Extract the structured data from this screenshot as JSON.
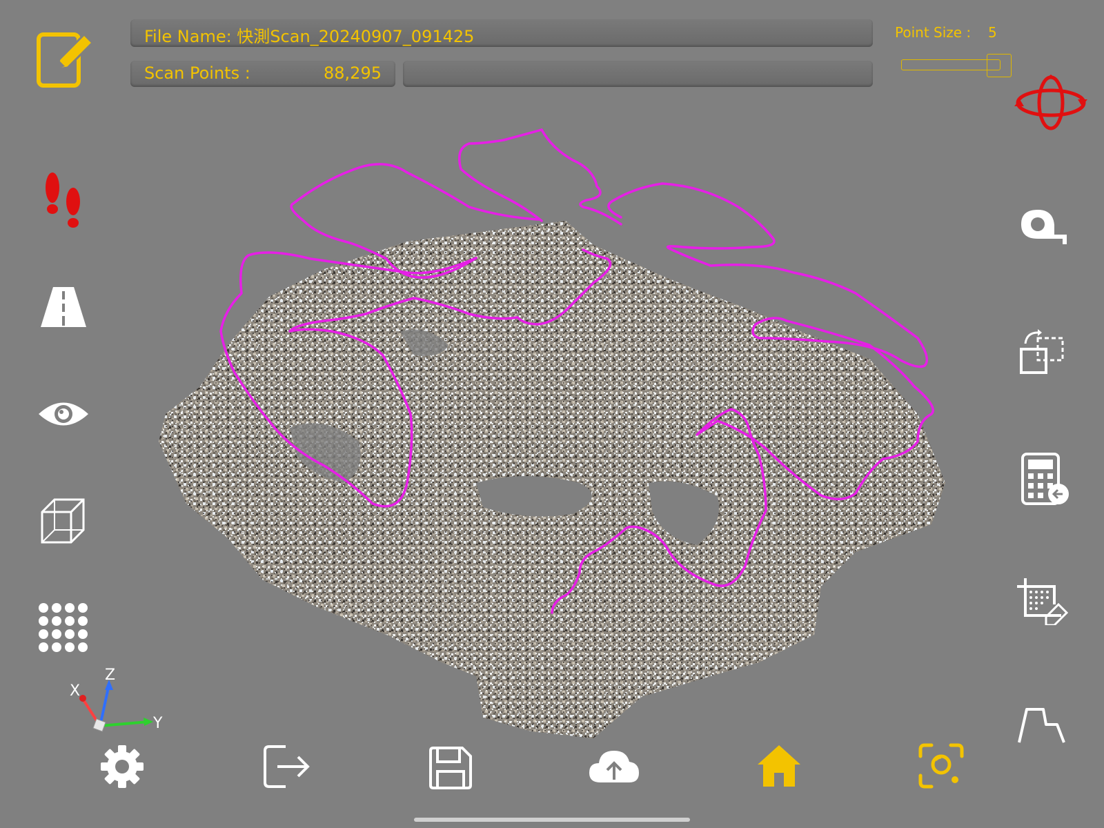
{
  "header": {
    "file_name_label": "File Name: 快測Scan_20240907_091425",
    "scan_points_label": "Scan Points :",
    "scan_points_value": "88,295",
    "point_size_label": "Point Size :",
    "point_size_value": "5"
  },
  "point_size_slider": {
    "value": 5,
    "max": 5
  },
  "axes": {
    "x": "X",
    "y": "Y",
    "z": "Z"
  },
  "left_toolbar": [
    "edit-icon",
    "footprints-icon",
    "road-icon",
    "eye-icon",
    "cube-icon",
    "dot-grid-icon"
  ],
  "right_toolbar": [
    "orbit-icon",
    "tape-measure-icon",
    "transform-icon",
    "calculator-icon",
    "crop-icon",
    "profile-icon"
  ],
  "bottom_toolbar": [
    "gear-icon",
    "exit-icon",
    "save-icon",
    "cloud-upload-icon",
    "home-icon",
    "scan-camera-icon"
  ],
  "colors": {
    "accent": "#F3C300",
    "background": "#808080",
    "annotation": "#E61FE6",
    "alert_red": "#E01010"
  }
}
